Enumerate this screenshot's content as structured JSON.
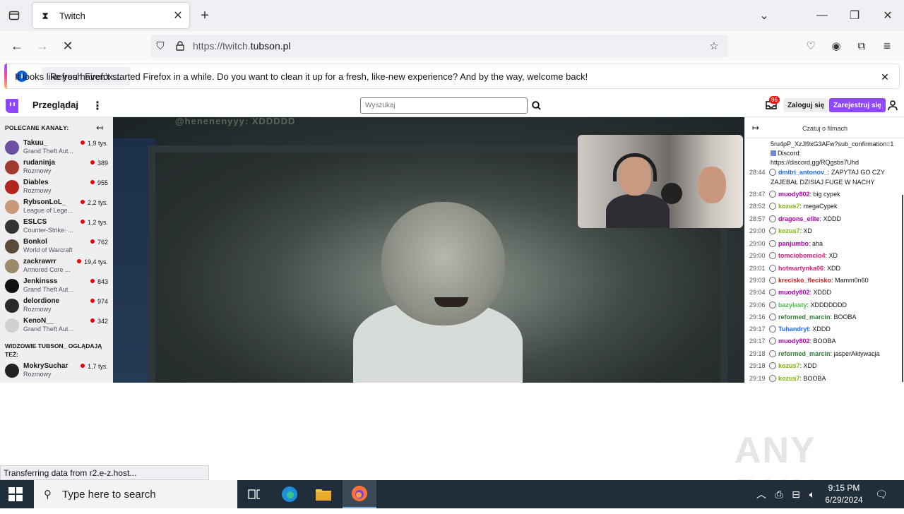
{
  "browser": {
    "tab_title": "Twitch",
    "url_prefix": "https://twitch.",
    "url_domain": "tubson.pl",
    "notification": "It looks like you haven’t started Firefox in a while. Do you want to clean it up for a fresh, like-new experience? And by the way, welcome back!",
    "refresh_label": "Refresh Firefox…",
    "status_text": "Transferring data from r2.e-z.host..."
  },
  "twitch": {
    "browse_label": "Przeglądaj",
    "search_placeholder": "Wyszukaj",
    "inbox_count": "96",
    "login_label": "Zaloguj się",
    "signup_label": "Zarejestruj się",
    "sidebar_header": "POLECANE KANAŁY:",
    "also_watch_header": "WIDZOWIE TUBSON_ OGLĄDAJĄ TEŻ:",
    "channels": [
      {
        "name": "Takuu_",
        "game": "Grand Theft Aut...",
        "viewers": "1,9 tys.",
        "color": "#6a4fa3"
      },
      {
        "name": "rudaninja",
        "game": "Rozmowy",
        "viewers": "389",
        "color": "#a03a30"
      },
      {
        "name": "Diables",
        "game": "Rozmowy",
        "viewers": "955",
        "color": "#b3261e"
      },
      {
        "name": "RybsonLoL_",
        "game": "League of Lege...",
        "viewers": "2,2 tys.",
        "color": "#c89a7a"
      },
      {
        "name": "ESLCS",
        "game": "Counter-Strike: ...",
        "viewers": "1,2 tys.",
        "color": "#333333"
      },
      {
        "name": "Bonkol",
        "game": "World of Warcraft",
        "viewers": "762",
        "color": "#5a4a3a"
      },
      {
        "name": "zackrawrr",
        "game": "Armored Core ...",
        "viewers": "19,4 tys.",
        "color": "#9a8a6a"
      },
      {
        "name": "Jenkinsss",
        "game": "Grand Theft Auto V",
        "viewers": "843",
        "color": "#111111"
      },
      {
        "name": "delordione",
        "game": "Rozmowy",
        "viewers": "974",
        "color": "#2a2a2a"
      },
      {
        "name": "KenoN__",
        "game": "Grand Theft Auto V",
        "viewers": "342",
        "color": "#d0d0d0"
      }
    ],
    "also_watch": [
      {
        "name": "MokrySuchar",
        "game": "Rozmowy",
        "viewers": "1,7 tys.",
        "color": "#222222"
      }
    ],
    "video_overlay_text": "@henenenyyy: XDDDDD",
    "chat_header": "Czatuj o filmach",
    "chat_pre_lines": [
      "5ru4pP_XzJl9xG3AFw?sub_confirmation=1",
      "Discord:",
      "https://discord.gg/RQgsbs7Uhd"
    ],
    "chat_messages": [
      {
        "ts": "28:44",
        "user": "dmitri_antonov_",
        "color": "#1e69ff",
        "text": "ZAPYTAJ GO CZY"
      },
      {
        "ts": "",
        "user": "",
        "color": "#000000",
        "text": "ZAJEBAŁ DZISIAJ FUGE W NACHY"
      },
      {
        "ts": "28:47",
        "user": "muody802",
        "color": "#b000b0",
        "text": "big cypek"
      },
      {
        "ts": "28:52",
        "user": "kozus7",
        "color": "#7ab800",
        "text": "megaCypek"
      },
      {
        "ts": "28:57",
        "user": "dragons_elite",
        "color": "#b000b0",
        "text": "XDDD"
      },
      {
        "ts": "29:00",
        "user": "kozus7",
        "color": "#7ab800",
        "text": "XD"
      },
      {
        "ts": "29:00",
        "user": "panjumbo",
        "color": "#b000b0",
        "text": "aha"
      },
      {
        "ts": "29:00",
        "user": "tomciobomcio4",
        "color": "#e0207a",
        "text": "XD"
      },
      {
        "ts": "29:01",
        "user": "hotmartynka06",
        "color": "#e0207a",
        "text": "XDD"
      },
      {
        "ts": "29:03",
        "user": "krecisko_flecisko",
        "color": "#d02020",
        "text": "Mamm0n60"
      },
      {
        "ts": "29:04",
        "user": "muody802",
        "color": "#b000b0",
        "text": "XDDD"
      },
      {
        "ts": "29:06",
        "user": "bazylasty",
        "color": "#4cc14c",
        "text": "XDDDDDDD"
      },
      {
        "ts": "29:16",
        "user": "reformed_marcin",
        "color": "#2e7d32",
        "text": "BOOBA"
      },
      {
        "ts": "29:17",
        "user": "Tuhandryt",
        "color": "#1e69ff",
        "text": "XDDD"
      },
      {
        "ts": "29:17",
        "user": "muody802",
        "color": "#b000b0",
        "text": "BOOBA"
      },
      {
        "ts": "29:18",
        "user": "reformed_marcin",
        "color": "#2e7d32",
        "text": "jasperAktywacja"
      },
      {
        "ts": "29:18",
        "user": "kozus7",
        "color": "#7ab800",
        "text": "XDD"
      },
      {
        "ts": "29:19",
        "user": "kozus7",
        "color": "#7ab800",
        "text": "BOOBA"
      }
    ]
  },
  "watermark": "ANY RUN",
  "taskbar": {
    "search_placeholder": "Type here to search",
    "time": "9:15 PM",
    "date": "6/29/2024"
  }
}
